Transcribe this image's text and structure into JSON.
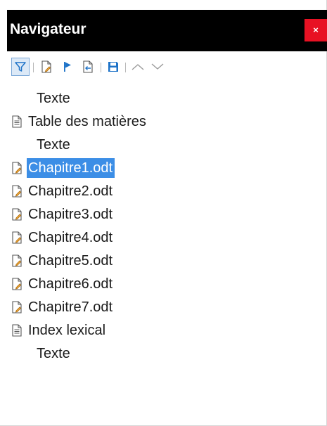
{
  "navigator": {
    "title": "Navigateur",
    "close_label": "×"
  },
  "toolbar": {
    "buttons": [
      {
        "icon": "filter-icon",
        "name": "content-view-toggle"
      },
      {
        "icon": "edit-document-icon",
        "name": "edit-button"
      },
      {
        "icon": "flag-icon",
        "name": "reminder-button"
      },
      {
        "icon": "insert-document-icon",
        "name": "insert-button"
      },
      {
        "icon": "save-icon",
        "name": "save-as-button"
      },
      {
        "icon": "chevron-up-icon",
        "name": "move-up-button"
      },
      {
        "icon": "chevron-down-icon",
        "name": "move-down-button"
      }
    ]
  },
  "tree": {
    "items": [
      {
        "label": "Texte",
        "type": "text"
      },
      {
        "label": "Table des matières",
        "type": "index"
      },
      {
        "label": "Texte",
        "type": "text"
      },
      {
        "label": "Chapitre1.odt",
        "type": "file",
        "selected": true
      },
      {
        "label": "Chapitre2.odt",
        "type": "file"
      },
      {
        "label": "Chapitre3.odt",
        "type": "file"
      },
      {
        "label": "Chapitre4.odt",
        "type": "file"
      },
      {
        "label": "Chapitre5.odt",
        "type": "file"
      },
      {
        "label": "Chapitre6.odt",
        "type": "file"
      },
      {
        "label": "Chapitre7.odt",
        "type": "file"
      },
      {
        "label": "Index lexical",
        "type": "index"
      },
      {
        "label": "Texte",
        "type": "text"
      }
    ]
  },
  "colors": {
    "titlebar": "#000000",
    "close": "#e81123",
    "selection": "#3c8ee6",
    "accent_blue": "#1e73c8"
  }
}
